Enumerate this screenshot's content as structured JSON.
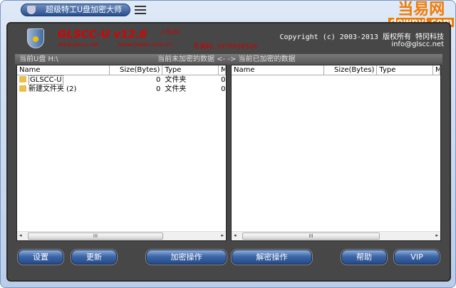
{
  "window": {
    "title": "超级特工U盘加密大师"
  },
  "logo": {
    "cn": "当易网",
    "en": "downyi.com"
  },
  "header": {
    "brand": "GLSCC-U v12.6",
    "run": "/ RUN",
    "site1": "www.glscc.net",
    "site2": "www.teeon.com.cn",
    "code": "专属码: 1976058526",
    "copyright": "Copyright (c) 2003-2013 版权所有 特冈科技",
    "email": "info@glscc.net"
  },
  "pathbar": {
    "current": "当前U盘 H:\\",
    "direction": "当前未加密的数据 <- -> 当前已加密的数据"
  },
  "columns": {
    "name": "Name",
    "size": "Size(Bytes)",
    "type": "Type",
    "m": "M"
  },
  "left_rows": [
    {
      "name": "GLSCC-U",
      "size": "0",
      "type": "文件夹",
      "m": "0"
    },
    {
      "name": "新建文件夹 (2)",
      "size": "0",
      "type": "文件夹",
      "m": "0"
    }
  ],
  "scroll": {
    "grip": "III",
    "left": "◂",
    "right": "▸"
  },
  "buttons": {
    "settings": "设置",
    "update": "更新",
    "encrypt": "加密操作",
    "decrypt": "解密操作",
    "help": "帮助",
    "vip": "VIP"
  }
}
